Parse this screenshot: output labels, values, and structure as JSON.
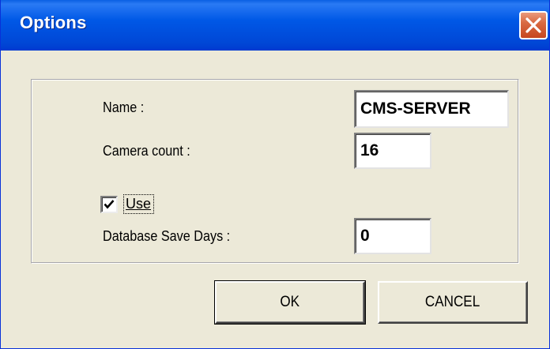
{
  "window": {
    "title": "Options",
    "close_icon": "close-icon"
  },
  "form": {
    "name_label": "Name :",
    "name_value": "CMS-SERVER",
    "camera_count_label": "Camera count :",
    "camera_count_value": "16",
    "use_label": "Use",
    "use_checked": true,
    "db_save_days_label": "Database Save Days :",
    "db_save_days_value": "0"
  },
  "buttons": {
    "ok_label": "OK",
    "cancel_label": "CANCEL"
  },
  "colors": {
    "title_bar": "#0054e3",
    "close_button": "#d9623a",
    "dialog_background": "#ece9d8"
  }
}
